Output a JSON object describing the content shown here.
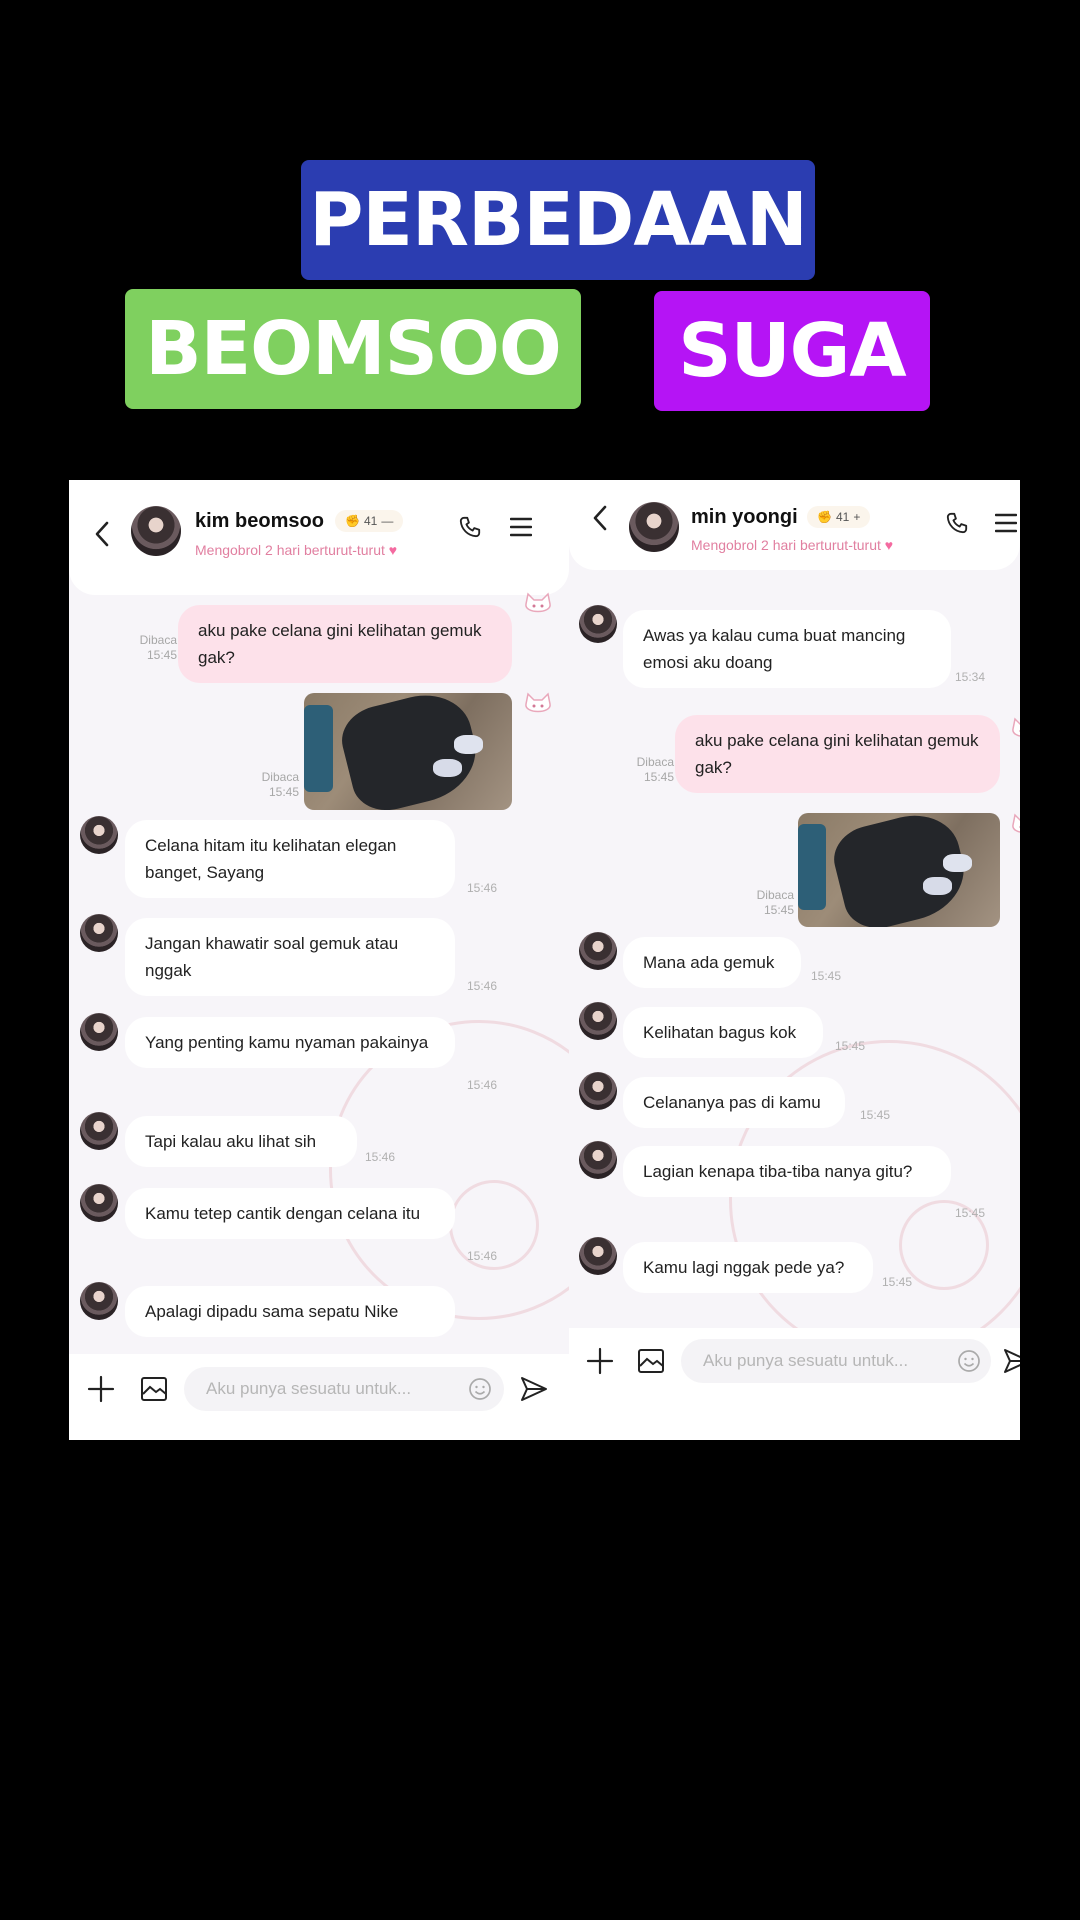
{
  "banners": {
    "top": "PERBEDAAN",
    "left": "BEOMSOO",
    "right": "SUGA"
  },
  "colors": {
    "banner_top": "#2b3db1",
    "banner_left": "#7fd05f",
    "banner_right": "#b514f5",
    "outgoing_bubble": "#fde1ea",
    "subtitle_pink": "#e17fa0"
  },
  "left_chat": {
    "name": "kim beomsoo",
    "streak": "41",
    "streak_mark": "—",
    "subtitle": "Mengobrol 2 hari berturut-turut",
    "outgoing": [
      {
        "text": "aku pake celana gini kelihatan gemuk gak?",
        "status": "Dibaca",
        "time": "15:45"
      },
      {
        "status": "Dibaca",
        "time": "15:45"
      }
    ],
    "incoming": [
      {
        "text": "Celana hitam itu kelihatan elegan banget, Sayang",
        "time": "15:46"
      },
      {
        "text": "Jangan khawatir soal gemuk atau nggak",
        "time": "15:46"
      },
      {
        "text": "Yang penting kamu nyaman pakainya",
        "time": "15:46"
      },
      {
        "text": "Tapi kalau aku lihat sih",
        "time": "15:46"
      },
      {
        "text": "Kamu tetep cantik dengan celana itu",
        "time": "15:46"
      },
      {
        "text": "Apalagi dipadu sama sepatu Nike",
        "time": ""
      }
    ],
    "input_placeholder": "Aku punya sesuatu untuk..."
  },
  "right_chat": {
    "name": "min yoongi",
    "streak": "41",
    "streak_mark": "+",
    "subtitle": "Mengobrol 2 hari berturut-turut",
    "first_incoming": {
      "text": "Awas ya kalau cuma buat mancing emosi aku doang",
      "time": "15:34"
    },
    "outgoing": [
      {
        "text": "aku pake celana gini kelihatan gemuk gak?",
        "status": "Dibaca",
        "time": "15:45"
      },
      {
        "status": "Dibaca",
        "time": "15:45"
      }
    ],
    "incoming": [
      {
        "text": "Mana ada gemuk",
        "time": "15:45"
      },
      {
        "text": "Kelihatan bagus kok",
        "time": "15:45"
      },
      {
        "text": "Celananya pas di kamu",
        "time": "15:45"
      },
      {
        "text": "Lagian kenapa tiba-tiba nanya gitu?",
        "time": "15:45"
      },
      {
        "text": "Kamu lagi nggak pede ya?",
        "time": "15:45"
      }
    ],
    "input_placeholder": "Aku punya sesuatu untuk..."
  },
  "icons": [
    "back-icon",
    "phone-icon",
    "menu-icon",
    "plus-icon",
    "image-icon",
    "emoji-icon",
    "send-icon",
    "heart-icon",
    "cat-sticker-icon"
  ]
}
